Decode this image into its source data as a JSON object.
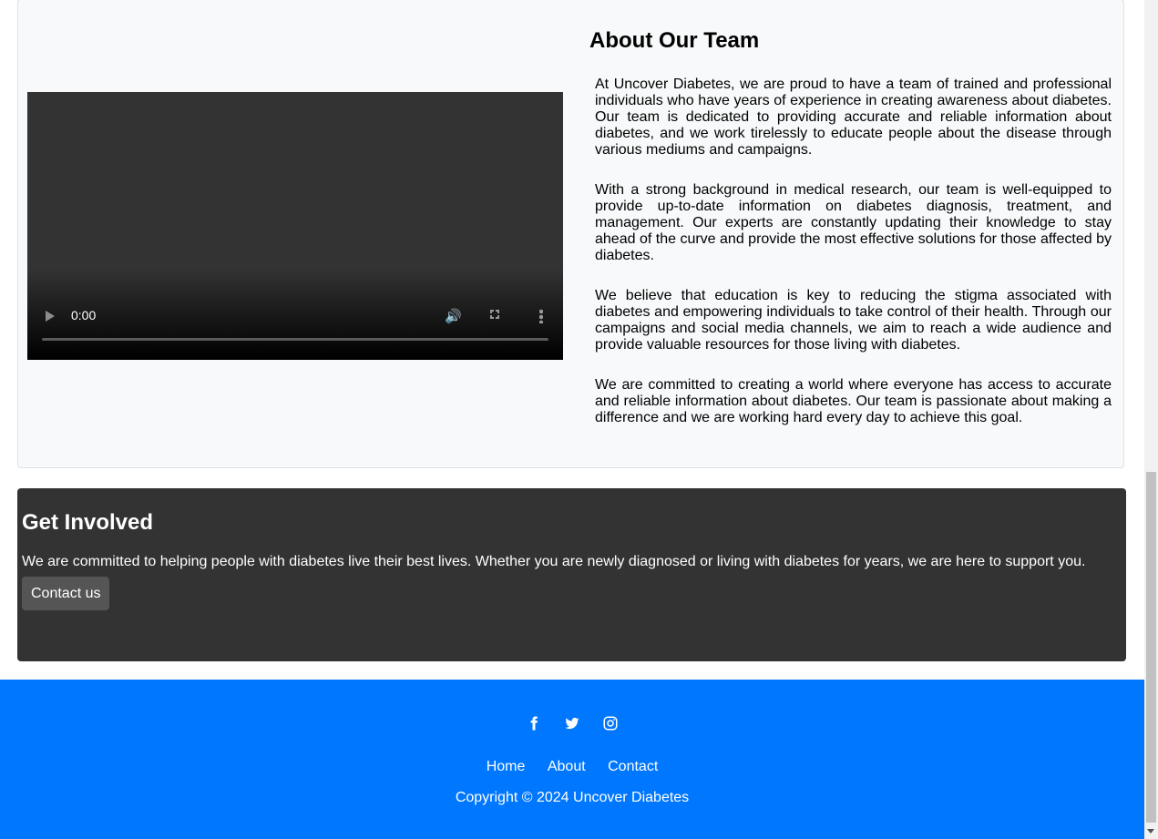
{
  "about": {
    "title": "About Our Team",
    "video": {
      "time": "0:00"
    },
    "paragraphs": [
      "At Uncover Diabetes, we are proud to have a team of trained and professional individuals who have years of experience in creating awareness about diabetes. Our team is dedicated to providing accurate and reliable information about diabetes, and we work tirelessly to educate people about the disease through various mediums and campaigns.",
      "With a strong background in medical research, our team is well-equipped to provide up-to-date information on diabetes diagnosis, treatment, and management. Our experts are constantly updating their knowledge to stay ahead of the curve and provide the most effective solutions for those affected by diabetes.",
      "We believe that education is key to reducing the stigma associated with diabetes and empowering individuals to take control of their health. Through our campaigns and social media channels, we aim to reach a wide audience and provide valuable resources for those living with diabetes.",
      "We are committed to creating a world where everyone has access to accurate and reliable information about diabetes. Our team is passionate about making a difference and we are working hard every day to achieve this goal."
    ]
  },
  "involved": {
    "title": "Get Involved",
    "text": "We are committed to helping people with diabetes live their best lives. Whether you are newly diagnosed or living with diabetes for years, we are here to support you.",
    "button": "Contact us"
  },
  "footer": {
    "social": [
      "facebook-icon",
      "twitter-icon",
      "instagram-icon"
    ],
    "links": [
      "Home",
      "About",
      "Contact"
    ],
    "copyright": "Copyright © 2024 Uncover Diabetes"
  },
  "colors": {
    "footer_bg": "#0077ff",
    "involved_bg": "#333333",
    "card_bg": "#f8f9fa"
  }
}
